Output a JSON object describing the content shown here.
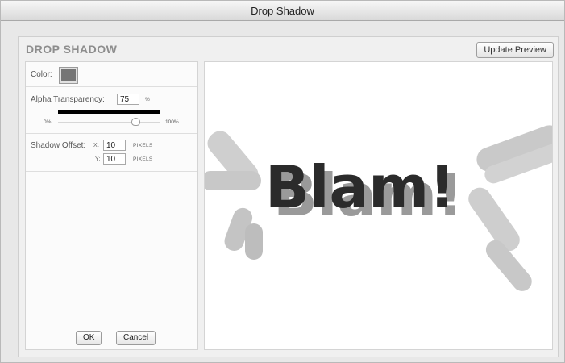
{
  "window": {
    "title": "Drop Shadow"
  },
  "header": {
    "title": "DROP SHADOW",
    "update_preview_label": "Update Preview"
  },
  "controls": {
    "color_label": "Color:",
    "color_value": "#757575",
    "alpha_label": "Alpha Transparency:",
    "alpha_value": "75",
    "alpha_unit": "%",
    "slider_min_label": "0%",
    "slider_max_label": "100%",
    "slider_level": 0.75,
    "offset_label": "Shadow Offset:",
    "x_label": "X:",
    "x_value": "10",
    "x_unit": "PIXELS",
    "y_label": "Y:",
    "y_value": "10",
    "y_unit": "PIXELS"
  },
  "footer": {
    "ok_label": "OK",
    "cancel_label": "Cancel"
  },
  "preview": {
    "text": "Blam!",
    "text_color": "#2b2b2b",
    "shadow_color": "#9a9a9a"
  }
}
